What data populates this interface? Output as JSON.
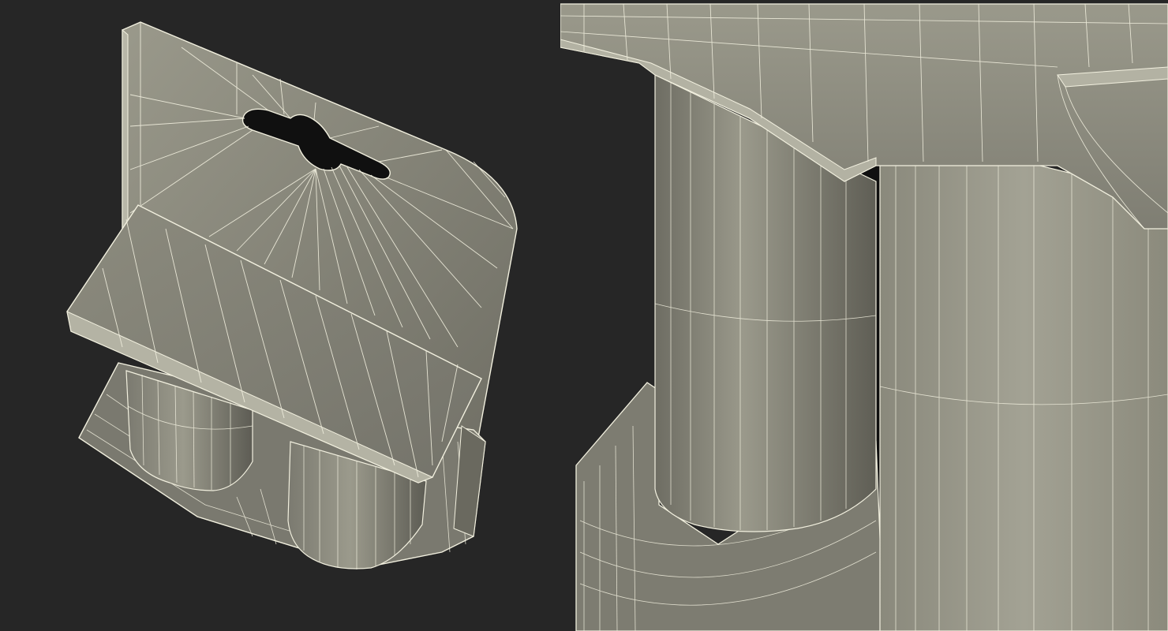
{
  "scene": {
    "background": "#262626",
    "surface": "#8b8a7c",
    "surface_dark": "#5f5e55",
    "surface_light": "#a3a294",
    "wire": "#f2f0df",
    "hole": "#101010"
  },
  "views": [
    {
      "id": "left",
      "subject": "six-pack-carrier-wireframe-overview-icon"
    },
    {
      "id": "right",
      "subject": "six-pack-carrier-wireframe-closeup-icon"
    }
  ]
}
